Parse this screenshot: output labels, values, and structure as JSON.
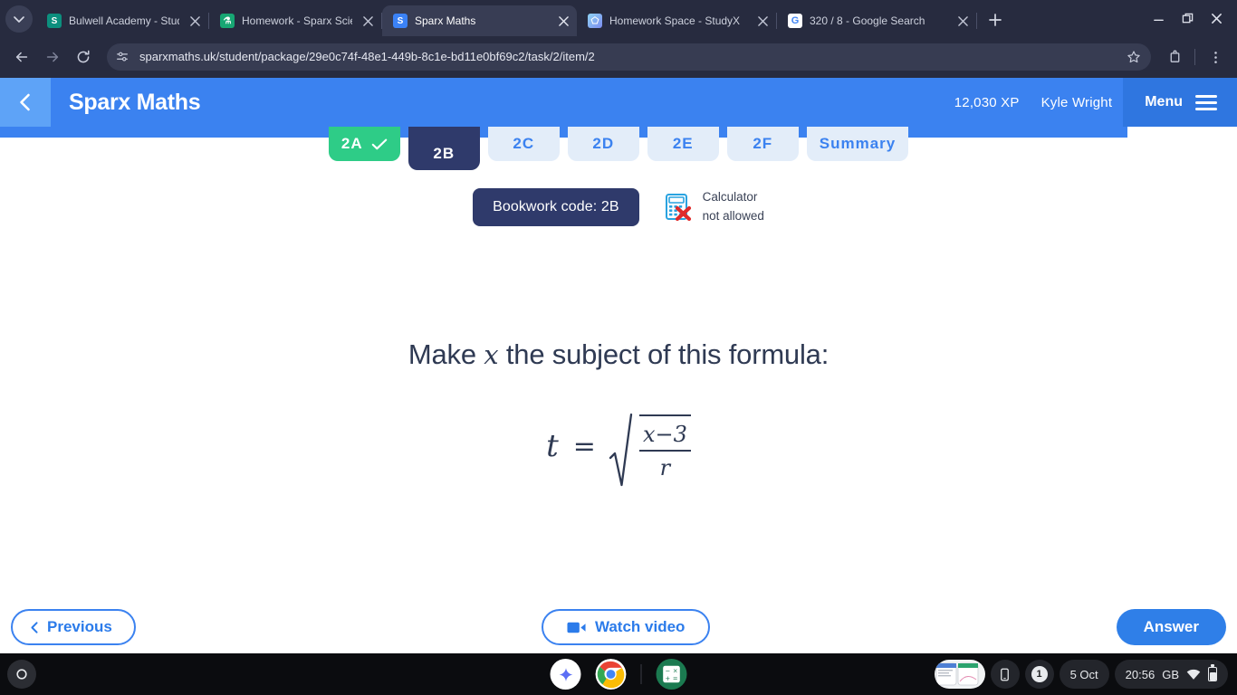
{
  "browser": {
    "tabs": [
      {
        "title": "Bulwell Academy - Student Ho",
        "favicon": "sparx-home-icon",
        "active": false
      },
      {
        "title": "Homework - Sparx Science",
        "favicon": "sparx-science-icon",
        "active": false
      },
      {
        "title": "Sparx Maths",
        "favicon": "sparx-maths-icon",
        "active": true
      },
      {
        "title": "Homework Space - StudyX",
        "favicon": "studyx-icon",
        "active": false
      },
      {
        "title": "320 / 8 - Google Search",
        "favicon": "google-icon",
        "active": false
      }
    ],
    "url": "sparxmaths.uk/student/package/29e0c74f-48e1-449b-8c1e-bd11e0bf69c2/task/2/item/2",
    "new_tab_label": "+",
    "nav": {
      "back": "back-arrow-icon",
      "forward": "forward-arrow-icon",
      "reload": "reload-icon"
    },
    "omnibox_icons": {
      "site_info": "site-settings-icon",
      "bookmark": "star-icon",
      "extensions": "extensions-icon",
      "menu": "three-dot-menu-icon"
    },
    "window_controls": {
      "minimize": "minimize-icon",
      "maximize": "maximize-icon",
      "close": "close-icon"
    }
  },
  "app": {
    "title": "Sparx Maths",
    "back_icon": "chevron-left-icon",
    "xp": "12,030 XP",
    "user": "Kyle Wright",
    "menu_label": "Menu",
    "accent_blue": "#3b82f0",
    "dark_navy": "#2f3a6b",
    "green": "#2ecc87"
  },
  "task_tabs": [
    {
      "label": "2A",
      "state": "done"
    },
    {
      "label": "2B",
      "state": "current"
    },
    {
      "label": "2C",
      "state": "todo"
    },
    {
      "label": "2D",
      "state": "todo"
    },
    {
      "label": "2E",
      "state": "todo"
    },
    {
      "label": "2F",
      "state": "todo"
    },
    {
      "label": "Summary",
      "state": "todo"
    }
  ],
  "meta": {
    "bookwork_code": "Bookwork code: 2B",
    "calculator_icon": "calculator-not-allowed-icon",
    "calculator_line1": "Calculator",
    "calculator_line2": "not allowed"
  },
  "question": {
    "text_before": "Make",
    "variable": "x",
    "text_after": "the subject of this formula:",
    "formula": {
      "lhs": "t",
      "operator": "=",
      "radicand_numerator": "x−3",
      "radicand_denominator": "r",
      "latex": "t = \\sqrt{\\dfrac{x-3}{r}}"
    }
  },
  "footer": {
    "previous_label": "Previous",
    "previous_icon": "chevron-left-icon",
    "watch_video_label": "Watch video",
    "watch_video_icon": "video-camera-icon",
    "answer_label": "Answer"
  },
  "shelf": {
    "launcher_icon": "launcher-circle-icon",
    "apps": [
      {
        "name": "gemini-icon"
      },
      {
        "name": "chrome-icon"
      },
      {
        "name": "calculator-icon"
      }
    ],
    "tray": {
      "window_preview": "window-preview-icon",
      "phone_hub_icon": "phone-hub-icon",
      "notification_count": "1",
      "date": "5 Oct",
      "time": "20:56",
      "locale": "GB",
      "wifi_icon": "wifi-icon",
      "battery_icon": "battery-icon"
    }
  }
}
